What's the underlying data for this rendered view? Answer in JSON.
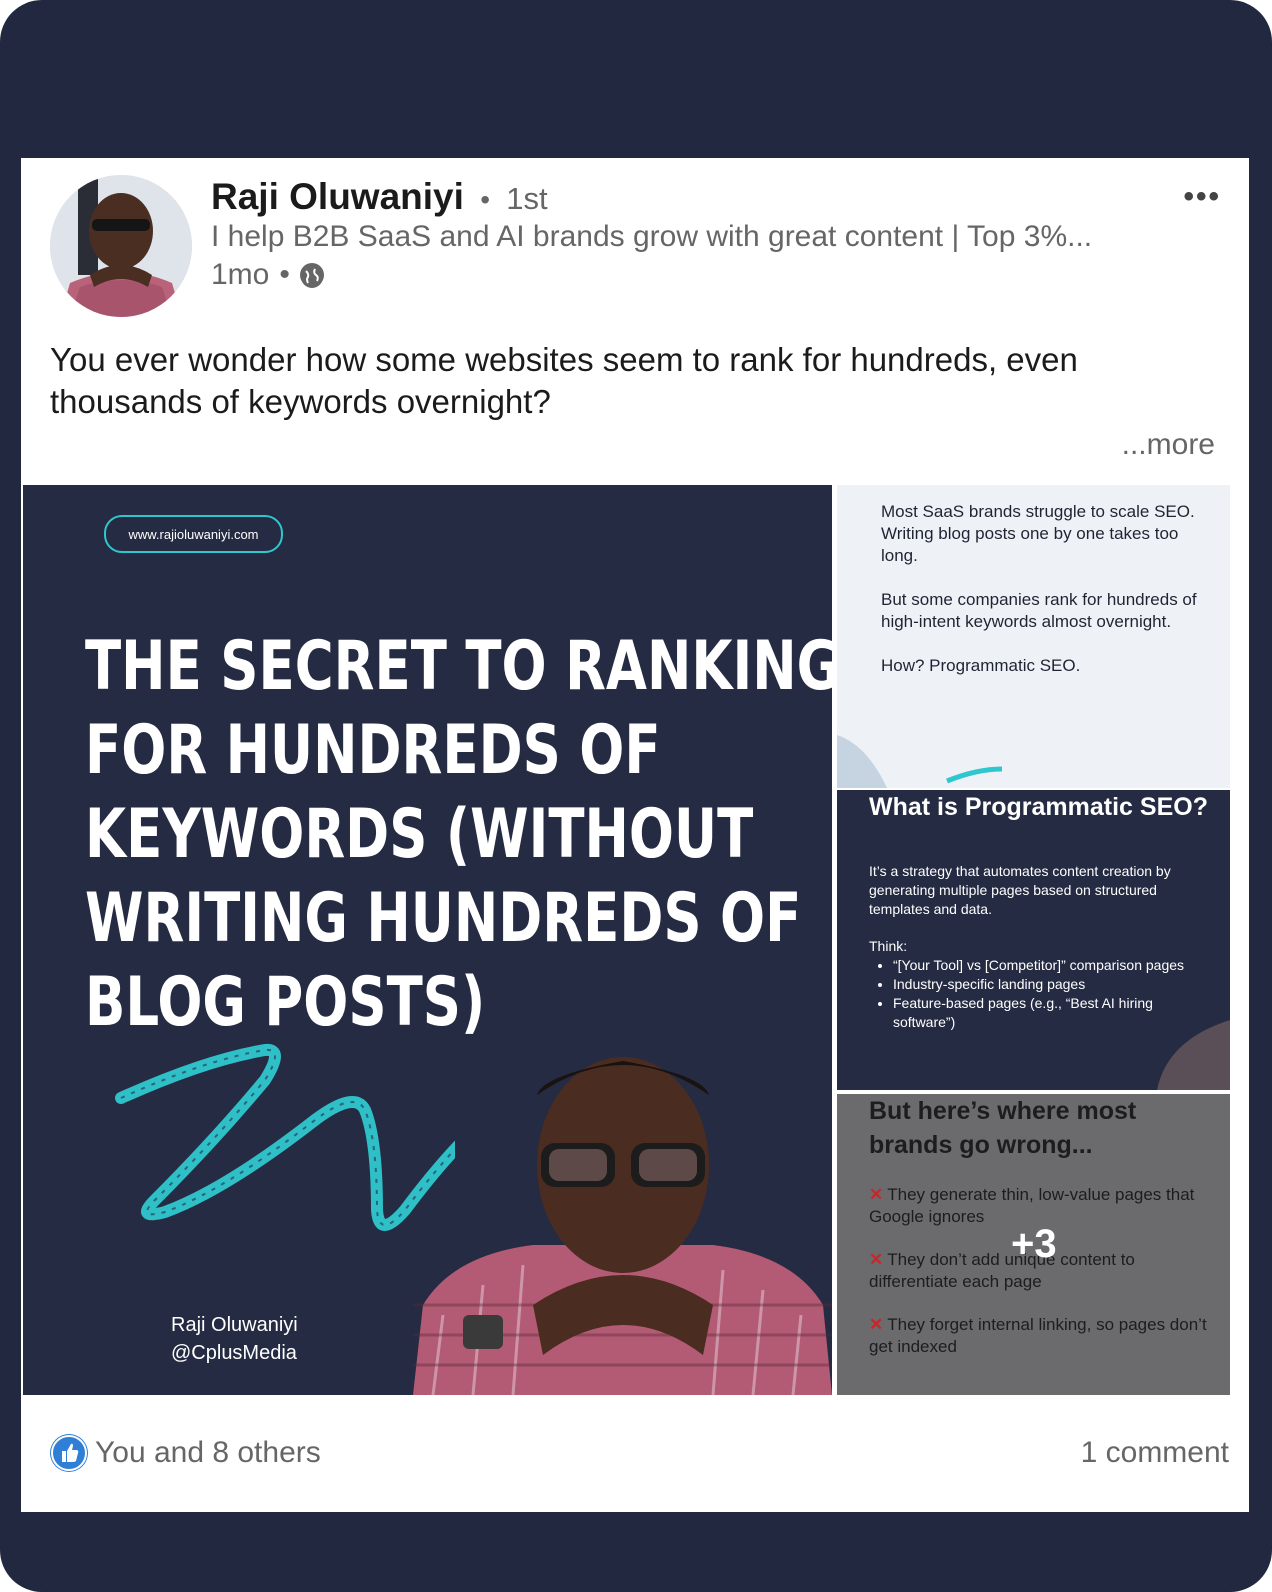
{
  "post": {
    "author_name": "Raji Oluwaniyi",
    "connection_degree": "1st",
    "separator": "•",
    "headline": "I help B2B SaaS and AI brands grow with great content | Top 3%...",
    "time_ago": "1mo",
    "visibility_icon": "globe-icon",
    "menu_icon": "•••",
    "text": "You ever wonder how some websites seem to rank for hundreds, even thousands of keywords overnight?",
    "see_more": "...more"
  },
  "media": {
    "main": {
      "url": "www.rajioluwaniyi.com",
      "title_lines": [
        "THE SECRET TO RANKING",
        "FOR HUNDREDS OF",
        "KEYWORDS (WITHOUT",
        "WRITING HUNDREDS OF",
        "BLOG POSTS)"
      ],
      "author_name": "Raji Oluwaniyi",
      "author_handle": "@CplusMedia",
      "accent_color": "#2fc7cf"
    },
    "thumb1": {
      "paragraphs": [
        "Most SaaS brands struggle to scale SEO. Writing blog posts one by one takes too long.",
        "But some companies rank for hundreds of high-intent keywords almost overnight.",
        "How? Programmatic SEO."
      ]
    },
    "thumb2": {
      "title": "What is Programmatic SEO?",
      "body": "It’s a strategy that automates content creation by generating multiple pages based on structured templates and data.",
      "think_label": "Think:",
      "bullets": [
        "“[Your Tool] vs [Competitor]” comparison pages",
        "Industry-specific landing pages",
        "Feature-based pages (e.g., “Best AI hiring software”)"
      ]
    },
    "thumb3": {
      "title": "But here’s where most brands go wrong...",
      "x_mark": "✕",
      "items": [
        "They generate thin, low-value pages that Google ignores",
        "They don’t add unique content to differentiate each page",
        "They forget internal linking, so pages don’t get indexed"
      ],
      "more_count": "+3"
    }
  },
  "footer": {
    "reaction_icon": "like-icon",
    "reactions_text": "You and 8 others",
    "comments_text": "1 comment"
  }
}
